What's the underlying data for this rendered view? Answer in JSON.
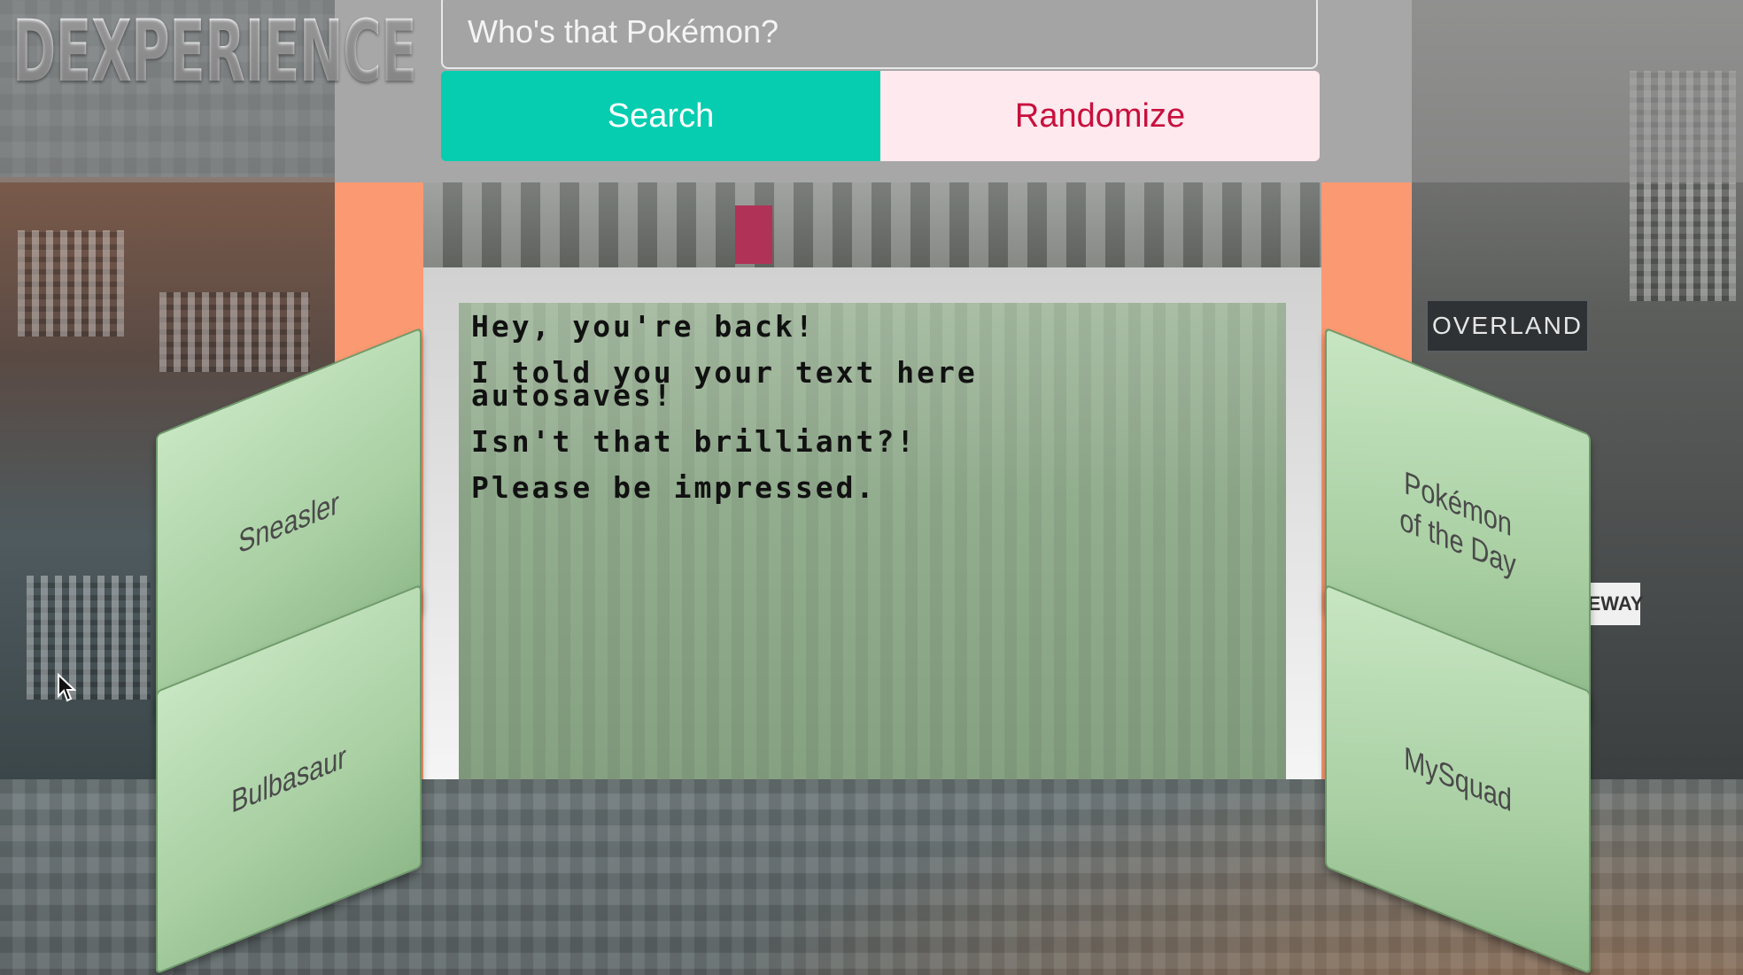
{
  "app": {
    "logo": "DEXPERIENCE"
  },
  "search": {
    "placeholder": "Who's that Pokémon?",
    "search_label": "Search",
    "randomize_label": "Randomize"
  },
  "notes": {
    "text": "Hey, you're back!\n\nI told you your text here\nautosaves!\n\nIsn't that brilliant?!\n\nPlease be impressed."
  },
  "cards": {
    "left_top": "Sneasler",
    "left_bottom": "Bulbasaur",
    "right_top": "Pokémon\nof the Day",
    "right_bottom": "MySquad"
  },
  "background": {
    "billboard": "OVERLAND",
    "sign": "EWAY"
  },
  "colors": {
    "search_button": "#06cdb0",
    "randomize_button_bg": "#fde9ee",
    "randomize_text": "#c8103e",
    "accent_salmon": "#fb9a72",
    "card_green": "#b5d9b0"
  }
}
